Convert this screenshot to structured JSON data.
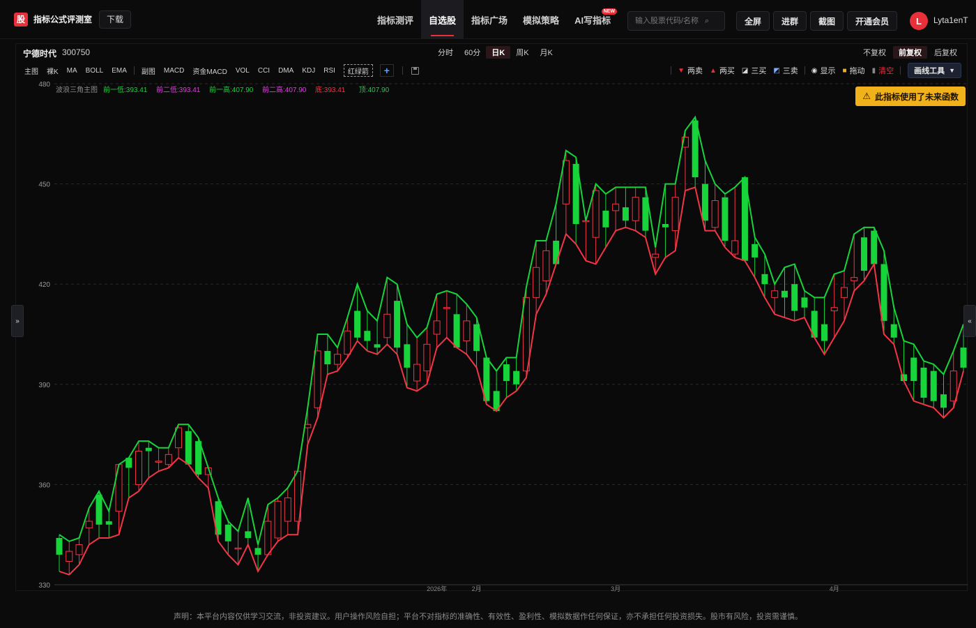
{
  "header": {
    "logo_char": "股",
    "brand": "指标公式评测室",
    "download": "下载",
    "nav": [
      {
        "label": "指标测评",
        "active": false
      },
      {
        "label": "自选股",
        "active": true
      },
      {
        "label": "指标广场",
        "active": false
      },
      {
        "label": "模拟策略",
        "active": false
      },
      {
        "label": "AI写指标",
        "active": false,
        "badge": "NEW"
      }
    ],
    "search_placeholder": "输入股票代码/名称",
    "buttons": [
      "全屏",
      "进群",
      "截图",
      "开通会员"
    ],
    "avatar": "L",
    "username": "Lyta1enT"
  },
  "stock": {
    "name": "宁德时代",
    "code": "300750"
  },
  "periods": [
    {
      "label": "分时",
      "active": false
    },
    {
      "label": "60分",
      "active": false
    },
    {
      "label": "日K",
      "active": true
    },
    {
      "label": "周K",
      "active": false
    },
    {
      "label": "月K",
      "active": false
    }
  ],
  "adjusts": [
    {
      "label": "不复权",
      "active": false
    },
    {
      "label": "前复权",
      "active": true
    },
    {
      "label": "后复权",
      "active": false
    }
  ],
  "indicator_bar": {
    "main_group": [
      "主图",
      "裸K",
      "MA",
      "BOLL",
      "EMA"
    ],
    "sub_group": [
      "副图",
      "MACD",
      "资金MACD",
      "VOL",
      "CCI",
      "DMA",
      "KDJ",
      "RSI"
    ],
    "custom": "红绿箭"
  },
  "draw_tools": {
    "two_sell": "两卖",
    "two_buy": "两买",
    "three_buy": "三买",
    "three_sell": "三卖",
    "show": "显示",
    "drag": "拖动",
    "clear": "清空",
    "draw": "画线工具"
  },
  "warning": "此指标使用了未来函数",
  "colors": {
    "up": "#f23645",
    "down": "#17d43b",
    "accent": "#e8303b",
    "warning_bg": "#f1b11b",
    "legend_green": "#17d43b",
    "legend_magenta": "#e040e0",
    "legend_red": "#f23645"
  },
  "disclaimer": "声明：本平台内容仅供学习交流，非投资建议。用户操作风险自担；平台不对指标的准确性、有效性、盈利性、模拟数据作任何保证，亦不承担任何投资损失。股市有风险，投资需谨慎。",
  "chart_data": {
    "type": "candlestick",
    "ylim": [
      330,
      480
    ],
    "yticks": [
      330,
      360,
      390,
      420,
      450,
      480
    ],
    "xticks": [
      {
        "label": "2026年",
        "index": 38
      },
      {
        "label": "2月",
        "index": 42
      },
      {
        "label": "3月",
        "index": 56
      },
      {
        "label": "4月",
        "index": 78
      }
    ],
    "legend": {
      "title": "波浪三角主图",
      "items": [
        {
          "label": "前一低:393.41",
          "color": "#17d43b"
        },
        {
          "label": "前二低:393.41",
          "color": "#e040e0"
        },
        {
          "label": "前一高:407.90",
          "color": "#17d43b"
        },
        {
          "label": "前二高:407.90",
          "color": "#e040e0"
        },
        {
          "label": "底:393.41",
          "color": "#f23645"
        },
        {
          "label": "顶:407.90",
          "color": "#17d43b"
        }
      ]
    },
    "candles": [
      {
        "o": 344,
        "h": 345,
        "l": 334,
        "c": 339
      },
      {
        "o": 337,
        "h": 343,
        "l": 333,
        "c": 340
      },
      {
        "o": 339,
        "h": 344,
        "l": 336,
        "c": 342
      },
      {
        "o": 347,
        "h": 353,
        "l": 342,
        "c": 349
      },
      {
        "o": 357,
        "h": 358,
        "l": 344,
        "c": 348
      },
      {
        "o": 349,
        "h": 352,
        "l": 344,
        "c": 348
      },
      {
        "o": 352,
        "h": 366,
        "l": 345,
        "c": 366
      },
      {
        "o": 368,
        "h": 366,
        "l": 356,
        "c": 365
      },
      {
        "o": 360,
        "h": 373,
        "l": 358,
        "c": 370
      },
      {
        "o": 371,
        "h": 373,
        "l": 362,
        "c": 370
      },
      {
        "o": 367,
        "h": 371,
        "l": 364,
        "c": 367
      },
      {
        "o": 366,
        "h": 371,
        "l": 365,
        "c": 369
      },
      {
        "o": 371,
        "h": 378,
        "l": 368,
        "c": 377
      },
      {
        "o": 376,
        "h": 378,
        "l": 366,
        "c": 366
      },
      {
        "o": 373,
        "h": 374,
        "l": 362,
        "c": 363
      },
      {
        "o": 363,
        "h": 364,
        "l": 359,
        "c": 365
      },
      {
        "o": 355,
        "h": 356,
        "l": 343,
        "c": 345
      },
      {
        "o": 348,
        "h": 349,
        "l": 339,
        "c": 343
      },
      {
        "o": 341,
        "h": 346,
        "l": 336,
        "c": 341
      },
      {
        "o": 346,
        "h": 356,
        "l": 342,
        "c": 344
      },
      {
        "o": 341,
        "h": 342,
        "l": 334,
        "c": 339
      },
      {
        "o": 339,
        "h": 354,
        "l": 339,
        "c": 349
      },
      {
        "o": 344,
        "h": 356,
        "l": 343,
        "c": 355
      },
      {
        "o": 349,
        "h": 359,
        "l": 345,
        "c": 356
      },
      {
        "o": 349,
        "h": 360,
        "l": 345,
        "c": 364
      },
      {
        "o": 377,
        "h": 383,
        "l": 372,
        "c": 378
      },
      {
        "o": 383,
        "h": 405,
        "l": 380,
        "c": 400
      },
      {
        "o": 400,
        "h": 405,
        "l": 393,
        "c": 396
      },
      {
        "o": 396,
        "h": 401,
        "l": 394,
        "c": 399
      },
      {
        "o": 399,
        "h": 410,
        "l": 398,
        "c": 406
      },
      {
        "o": 412,
        "h": 420,
        "l": 403,
        "c": 404
      },
      {
        "o": 406,
        "h": 412,
        "l": 400,
        "c": 403
      },
      {
        "o": 402,
        "h": 409,
        "l": 399,
        "c": 401
      },
      {
        "o": 404,
        "h": 422,
        "l": 402,
        "c": 411
      },
      {
        "o": 415,
        "h": 420,
        "l": 399,
        "c": 401
      },
      {
        "o": 402,
        "h": 408,
        "l": 389,
        "c": 395
      },
      {
        "o": 391,
        "h": 404,
        "l": 388,
        "c": 396
      },
      {
        "o": 394,
        "h": 407,
        "l": 390,
        "c": 402
      },
      {
        "o": 405,
        "h": 417,
        "l": 401,
        "c": 409
      },
      {
        "o": 413,
        "h": 418,
        "l": 404,
        "c": 413
      },
      {
        "o": 411,
        "h": 417,
        "l": 401,
        "c": 401
      },
      {
        "o": 403,
        "h": 414,
        "l": 399,
        "c": 409
      },
      {
        "o": 408,
        "h": 410,
        "l": 395,
        "c": 400
      },
      {
        "o": 398,
        "h": 398,
        "l": 384,
        "c": 385
      },
      {
        "o": 388,
        "h": 394,
        "l": 382,
        "c": 382
      },
      {
        "o": 396,
        "h": 398,
        "l": 386,
        "c": 391
      },
      {
        "o": 394,
        "h": 398,
        "l": 388,
        "c": 390
      },
      {
        "o": 394,
        "h": 419,
        "l": 392,
        "c": 416
      },
      {
        "o": 416,
        "h": 433,
        "l": 411,
        "c": 425
      },
      {
        "o": 421,
        "h": 433,
        "l": 417,
        "c": 430
      },
      {
        "o": 433,
        "h": 444,
        "l": 426,
        "c": 426
      },
      {
        "o": 444,
        "h": 460,
        "l": 435,
        "c": 457
      },
      {
        "o": 456,
        "h": 458,
        "l": 432,
        "c": 438
      },
      {
        "o": 439,
        "h": 439,
        "l": 427,
        "c": 439
      },
      {
        "o": 434,
        "h": 450,
        "l": 426,
        "c": 448
      },
      {
        "o": 442,
        "h": 447,
        "l": 431,
        "c": 437
      },
      {
        "o": 442,
        "h": 449,
        "l": 436,
        "c": 444
      },
      {
        "o": 443,
        "h": 449,
        "l": 437,
        "c": 439
      },
      {
        "o": 439,
        "h": 449,
        "l": 436,
        "c": 446
      },
      {
        "o": 446,
        "h": 449,
        "l": 434,
        "c": 436
      },
      {
        "o": 428,
        "h": 431,
        "l": 423,
        "c": 429
      },
      {
        "o": 438,
        "h": 450,
        "l": 428,
        "c": 437
      },
      {
        "o": 436,
        "h": 450,
        "l": 430,
        "c": 446
      },
      {
        "o": 461,
        "h": 466,
        "l": 448,
        "c": 464
      },
      {
        "o": 469,
        "h": 470,
        "l": 449,
        "c": 452
      },
      {
        "o": 450,
        "h": 457,
        "l": 436,
        "c": 439
      },
      {
        "o": 437,
        "h": 450,
        "l": 436,
        "c": 445
      },
      {
        "o": 446,
        "h": 447,
        "l": 431,
        "c": 433
      },
      {
        "o": 429,
        "h": 449,
        "l": 428,
        "c": 433
      },
      {
        "o": 452,
        "h": 450,
        "l": 427,
        "c": 427
      },
      {
        "o": 432,
        "h": 434,
        "l": 422,
        "c": 428
      },
      {
        "o": 423,
        "h": 429,
        "l": 416,
        "c": 420
      },
      {
        "o": 416,
        "h": 420,
        "l": 411,
        "c": 418
      },
      {
        "o": 418,
        "h": 425,
        "l": 410,
        "c": 416
      },
      {
        "o": 420,
        "h": 426,
        "l": 409,
        "c": 412
      },
      {
        "o": 416,
        "h": 418,
        "l": 410,
        "c": 413
      },
      {
        "o": 412,
        "h": 416,
        "l": 406,
        "c": 404
      },
      {
        "o": 408,
        "h": 416,
        "l": 399,
        "c": 403
      },
      {
        "o": 412,
        "h": 423,
        "l": 404,
        "c": 413
      },
      {
        "o": 416,
        "h": 424,
        "l": 409,
        "c": 419
      },
      {
        "o": 421,
        "h": 435,
        "l": 418,
        "c": 422
      },
      {
        "o": 434,
        "h": 437,
        "l": 421,
        "c": 424
      },
      {
        "o": 436,
        "h": 437,
        "l": 426,
        "c": 426
      },
      {
        "o": 426,
        "h": 430,
        "l": 405,
        "c": 409
      },
      {
        "o": 408,
        "h": 413,
        "l": 402,
        "c": 404
      },
      {
        "o": 393,
        "h": 403,
        "l": 391,
        "c": 391
      },
      {
        "o": 398,
        "h": 402,
        "l": 385,
        "c": 391
      },
      {
        "o": 395,
        "h": 397,
        "l": 384,
        "c": 386
      },
      {
        "o": 394,
        "h": 396,
        "l": 383,
        "c": 385
      },
      {
        "o": 387,
        "h": 393,
        "l": 380,
        "c": 383
      },
      {
        "o": 385,
        "h": 400,
        "l": 383,
        "c": 394
      },
      {
        "o": 401,
        "h": 408,
        "l": 394,
        "c": 395
      }
    ]
  }
}
